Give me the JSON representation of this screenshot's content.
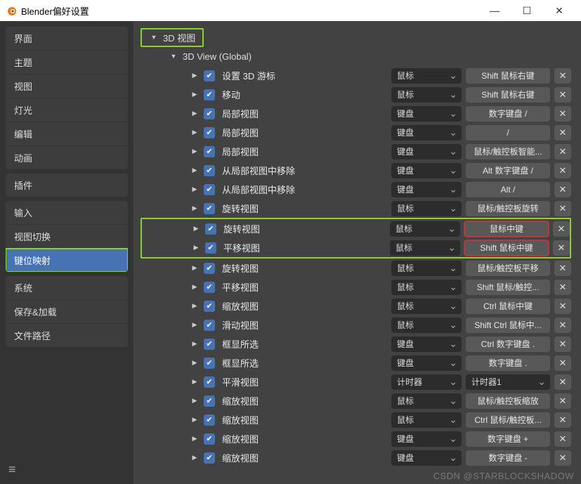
{
  "window": {
    "title": "Blender偏好设置"
  },
  "sidebar": {
    "groups": [
      {
        "items": [
          "界面",
          "主题",
          "视图",
          "灯光",
          "编辑",
          "动画"
        ]
      },
      {
        "items": [
          "插件"
        ]
      },
      {
        "items": [
          "输入",
          "视图切换",
          "键位映射"
        ],
        "active": 2
      },
      {
        "items": [
          "系统",
          "保存&加载",
          "文件路径"
        ]
      }
    ]
  },
  "tree": {
    "header1": "3D 视图",
    "header2": "3D View (Global)",
    "rows": [
      {
        "label": "设置 3D 游标",
        "type": "鼠标",
        "key": "Shift 鼠标右键"
      },
      {
        "label": "移动",
        "type": "鼠标",
        "key": "Shift 鼠标右键"
      },
      {
        "label": "局部视图",
        "type": "键盘",
        "key": "数字键盘 /"
      },
      {
        "label": "局部视图",
        "type": "键盘",
        "key": "/"
      },
      {
        "label": "局部视图",
        "type": "键盘",
        "key": "鼠标/触控板智能..."
      },
      {
        "label": "从局部视图中移除",
        "type": "键盘",
        "key": "Alt 数字键盘 /"
      },
      {
        "label": "从局部视图中移除",
        "type": "键盘",
        "key": "Alt /"
      },
      {
        "label": "旋转视图",
        "type": "鼠标",
        "key": "鼠标/触控板旋转"
      },
      {
        "label": "旋转视图",
        "type": "鼠标",
        "key": "鼠标中键",
        "hlr": true
      },
      {
        "label": "平移视图",
        "type": "鼠标",
        "key": "Shift 鼠标中键",
        "hlr": true
      },
      {
        "label": "旋转视图",
        "type": "鼠标",
        "key": "鼠标/触控板平移"
      },
      {
        "label": "平移视图",
        "type": "鼠标",
        "key": "Shift 鼠标/触控..."
      },
      {
        "label": "缩放视图",
        "type": "鼠标",
        "key": "Ctrl 鼠标中键"
      },
      {
        "label": "滑动视图",
        "type": "鼠标",
        "key": "Shift Ctrl 鼠标中..."
      },
      {
        "label": "框显所选",
        "type": "键盘",
        "key": "Ctrl 数字键盘 ."
      },
      {
        "label": "框显所选",
        "type": "键盘",
        "key": "数字键盘 ."
      },
      {
        "label": "平滑视图",
        "type": "计时器",
        "key": "计时器1",
        "keysel": true
      },
      {
        "label": "缩放视图",
        "type": "鼠标",
        "key": "鼠标/触控板缩放"
      },
      {
        "label": "缩放视图",
        "type": "鼠标",
        "key": "Ctrl 鼠标/触控板..."
      },
      {
        "label": "缩放视图",
        "type": "键盘",
        "key": "数字键盘 +"
      },
      {
        "label": "缩放视图",
        "type": "键盘",
        "key": "数字键盘 -"
      }
    ]
  },
  "watermark": "CSDN @STARBLOCKSHADOW"
}
